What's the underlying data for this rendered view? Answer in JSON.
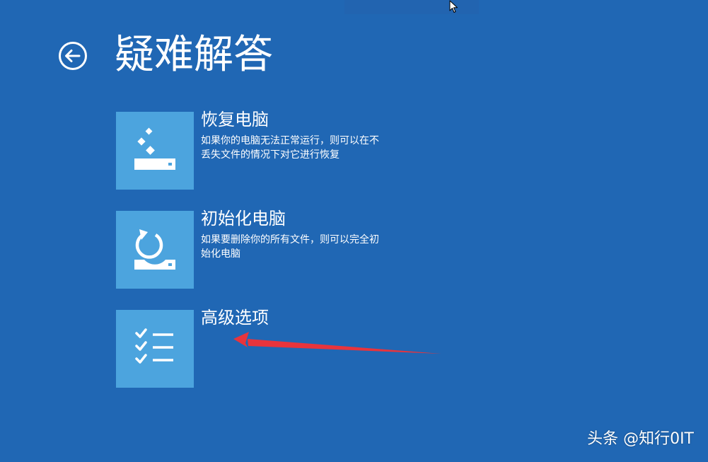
{
  "page": {
    "title": "疑难解答"
  },
  "nav": {
    "back_icon": "back-arrow-icon"
  },
  "options": [
    {
      "title": "恢复电脑",
      "description": "如果你的电脑无法正常运行，则可以在不丢失文件的情况下对它进行恢复",
      "icon": "refresh-drive-icon"
    },
    {
      "title": "初始化电脑",
      "description": "如果要删除你的所有文件，则可以完全初始化电脑",
      "icon": "reset-drive-icon"
    },
    {
      "title": "高级选项",
      "description": "",
      "icon": "checklist-icon"
    }
  ],
  "watermark": "头条 @知行0IT",
  "colors": {
    "background": "#2067b4",
    "tile": "#4ca4de",
    "text": "#ffffff",
    "annotation_arrow": "#e8343c"
  }
}
